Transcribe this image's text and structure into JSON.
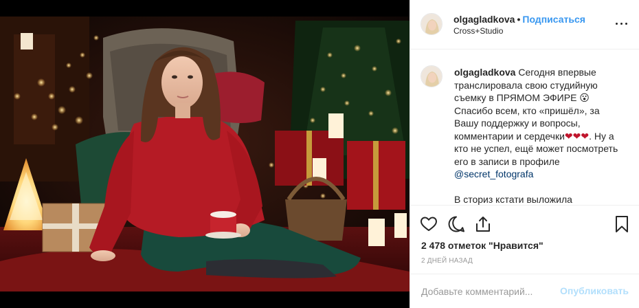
{
  "post": {
    "username": "olgagladkova",
    "separator": "•",
    "follow_label": "Подписаться",
    "location": "Cross+Studio"
  },
  "caption": {
    "username": "olgagladkova",
    "line1": "Сегодня впервые",
    "line2": "транслировала свою студийную",
    "line3": "съемку в ПРЯМОМ ЭФИРЕ 😮",
    "line4": "Спасибо всем, кто «пришёл», за",
    "line5": "Вашу поддержку и вопросы,",
    "line6_text": "комментарии и сердечки",
    "line6_hearts": "❤❤❤",
    "line6_after": ". Ну а",
    "line7": "кто не успел, ещё может посмотреть",
    "line8": "его в записи в профиле",
    "mention": "@secret_fotografa",
    "line10": "В сториз кстати выложила"
  },
  "actions": {
    "like_icon": "heart-outline-icon",
    "comment_icon": "comment-icon",
    "share_icon": "share-icon",
    "save_icon": "bookmark-icon",
    "likes_text": "2 478 отметок \"Нравится\"",
    "date_text": "2 ДНЕЙ НАЗАД"
  },
  "add_comment": {
    "placeholder": "Добавьте комментарий...",
    "publish_label": "Опубликовать"
  },
  "colors": {
    "link": "#3897f0",
    "mention": "#003569",
    "publish_disabled": "#b2dffc",
    "muted": "#999999",
    "heart": "#c0162d"
  }
}
